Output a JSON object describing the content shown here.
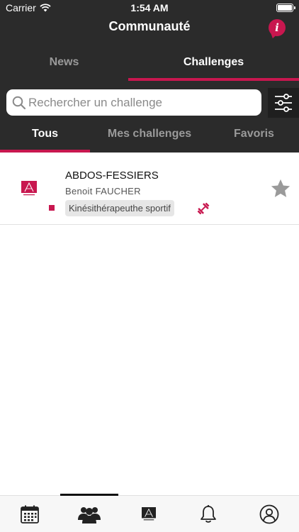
{
  "status_bar": {
    "carrier": "Carrier",
    "time": "1:54 AM"
  },
  "header": {
    "title": "Communauté"
  },
  "top_tabs": [
    {
      "label": "News",
      "active": false
    },
    {
      "label": "Challenges",
      "active": true
    }
  ],
  "search": {
    "placeholder": "Rechercher un challenge",
    "value": ""
  },
  "sub_tabs": [
    {
      "label": "Tous",
      "active": true
    },
    {
      "label": "Mes challenges",
      "active": false
    },
    {
      "label": "Favoris",
      "active": false
    }
  ],
  "challenges": [
    {
      "title": "ABDOS-FESSIERS",
      "author": "Benoit FAUCHER",
      "tag": "Kinésithérapeuthe sportif",
      "favorite": false,
      "icons": [
        "brand-logo-icon",
        "dumbbell-icon",
        "star-icon"
      ]
    }
  ],
  "tab_bar": {
    "items": [
      "calendar-icon",
      "community-icon",
      "brand-logo-icon",
      "bell-icon",
      "profile-icon"
    ],
    "active_index": 1
  },
  "colors": {
    "accent": "#c8174f",
    "header_bg": "#2b2b2b",
    "inactive_tab": "#9a9a9a"
  }
}
